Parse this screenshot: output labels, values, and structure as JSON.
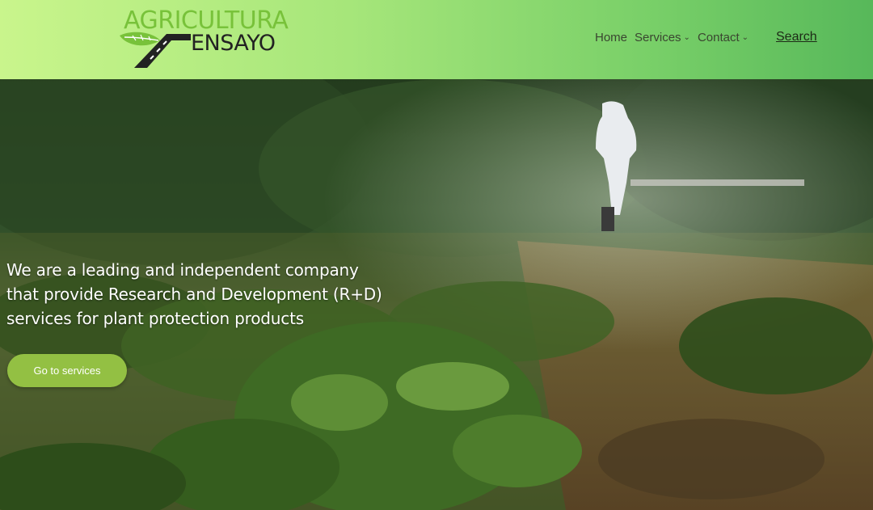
{
  "brand": {
    "logo_line1": "AGRICULTURA",
    "logo_line2": "ENSAYO",
    "accent_color": "#78c23a"
  },
  "nav": {
    "items": [
      {
        "label": "Home",
        "has_dropdown": false
      },
      {
        "label": "Services",
        "has_dropdown": true
      },
      {
        "label": "Contact",
        "has_dropdown": true
      }
    ],
    "search_label": "Search"
  },
  "hero": {
    "headline": "We are a leading and independent company that provide Research and Development (R+D) services for plant protection products",
    "cta_label": "Go to services",
    "cta_color": "#93c043"
  },
  "icons": {
    "dropdown": "chevron-down-icon",
    "logo_mark": "leaf-road-icon"
  }
}
